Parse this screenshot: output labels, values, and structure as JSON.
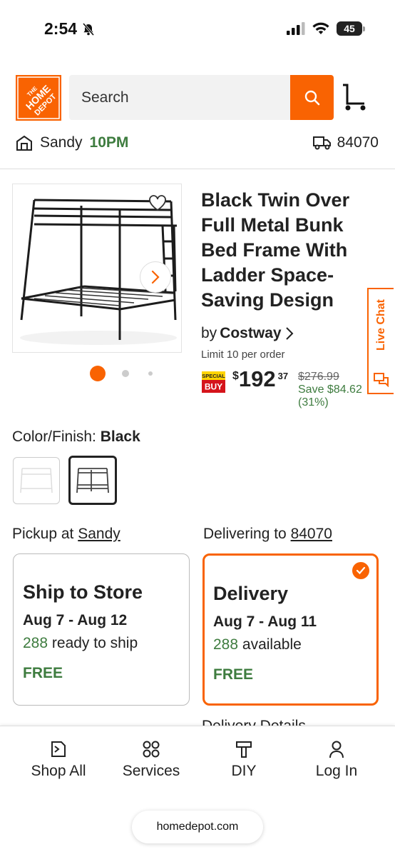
{
  "status_bar": {
    "time": "2:54",
    "battery": "45"
  },
  "header": {
    "logo_text": "THE HOME DEPOT",
    "search_placeholder": "Search"
  },
  "store": {
    "name": "Sandy",
    "hours": "10PM",
    "zip": "84070"
  },
  "product": {
    "title": "Black Twin Over Full Metal Bunk Bed Frame With Ladder Space-Saving Design",
    "by": "by",
    "brand": "Costway",
    "limit": "Limit 10 per order",
    "special_badge_top": "SPECIAL",
    "special_badge_bottom": "BUY",
    "price_currency": "$",
    "price_dollars": "192",
    "price_cents": "37",
    "was_price": "$276.99",
    "save_amount": "Save $84.62",
    "save_percent": "(31%)",
    "image_count": 3,
    "active_image": 1
  },
  "live_chat": {
    "label": "Live Chat"
  },
  "color_finish": {
    "label": "Color/Finish:",
    "selected": "Black",
    "options": [
      "White",
      "Black"
    ]
  },
  "fulfillment": {
    "pickup_prefix": "Pickup at",
    "pickup_store": "Sandy",
    "delivery_prefix": "Delivering to",
    "delivery_zip": "84070",
    "ship_to_store": {
      "title": "Ship to Store",
      "dates": "Aug 7 - Aug 12",
      "count": "288",
      "avail_text": "ready to ship",
      "price": "FREE"
    },
    "delivery": {
      "title": "Delivery",
      "dates": "Aug 7 - Aug 11",
      "count": "288",
      "avail_text": "available",
      "price": "FREE",
      "selected": true
    },
    "partial_heading": "Delivery Details"
  },
  "bottom_nav": {
    "shop_all": "Shop All",
    "services": "Services",
    "diy": "DIY",
    "log_in": "Log In"
  },
  "browser": {
    "url": "homedepot.com"
  },
  "colors": {
    "brand_orange": "#f96302",
    "green": "#3e7c3f"
  }
}
